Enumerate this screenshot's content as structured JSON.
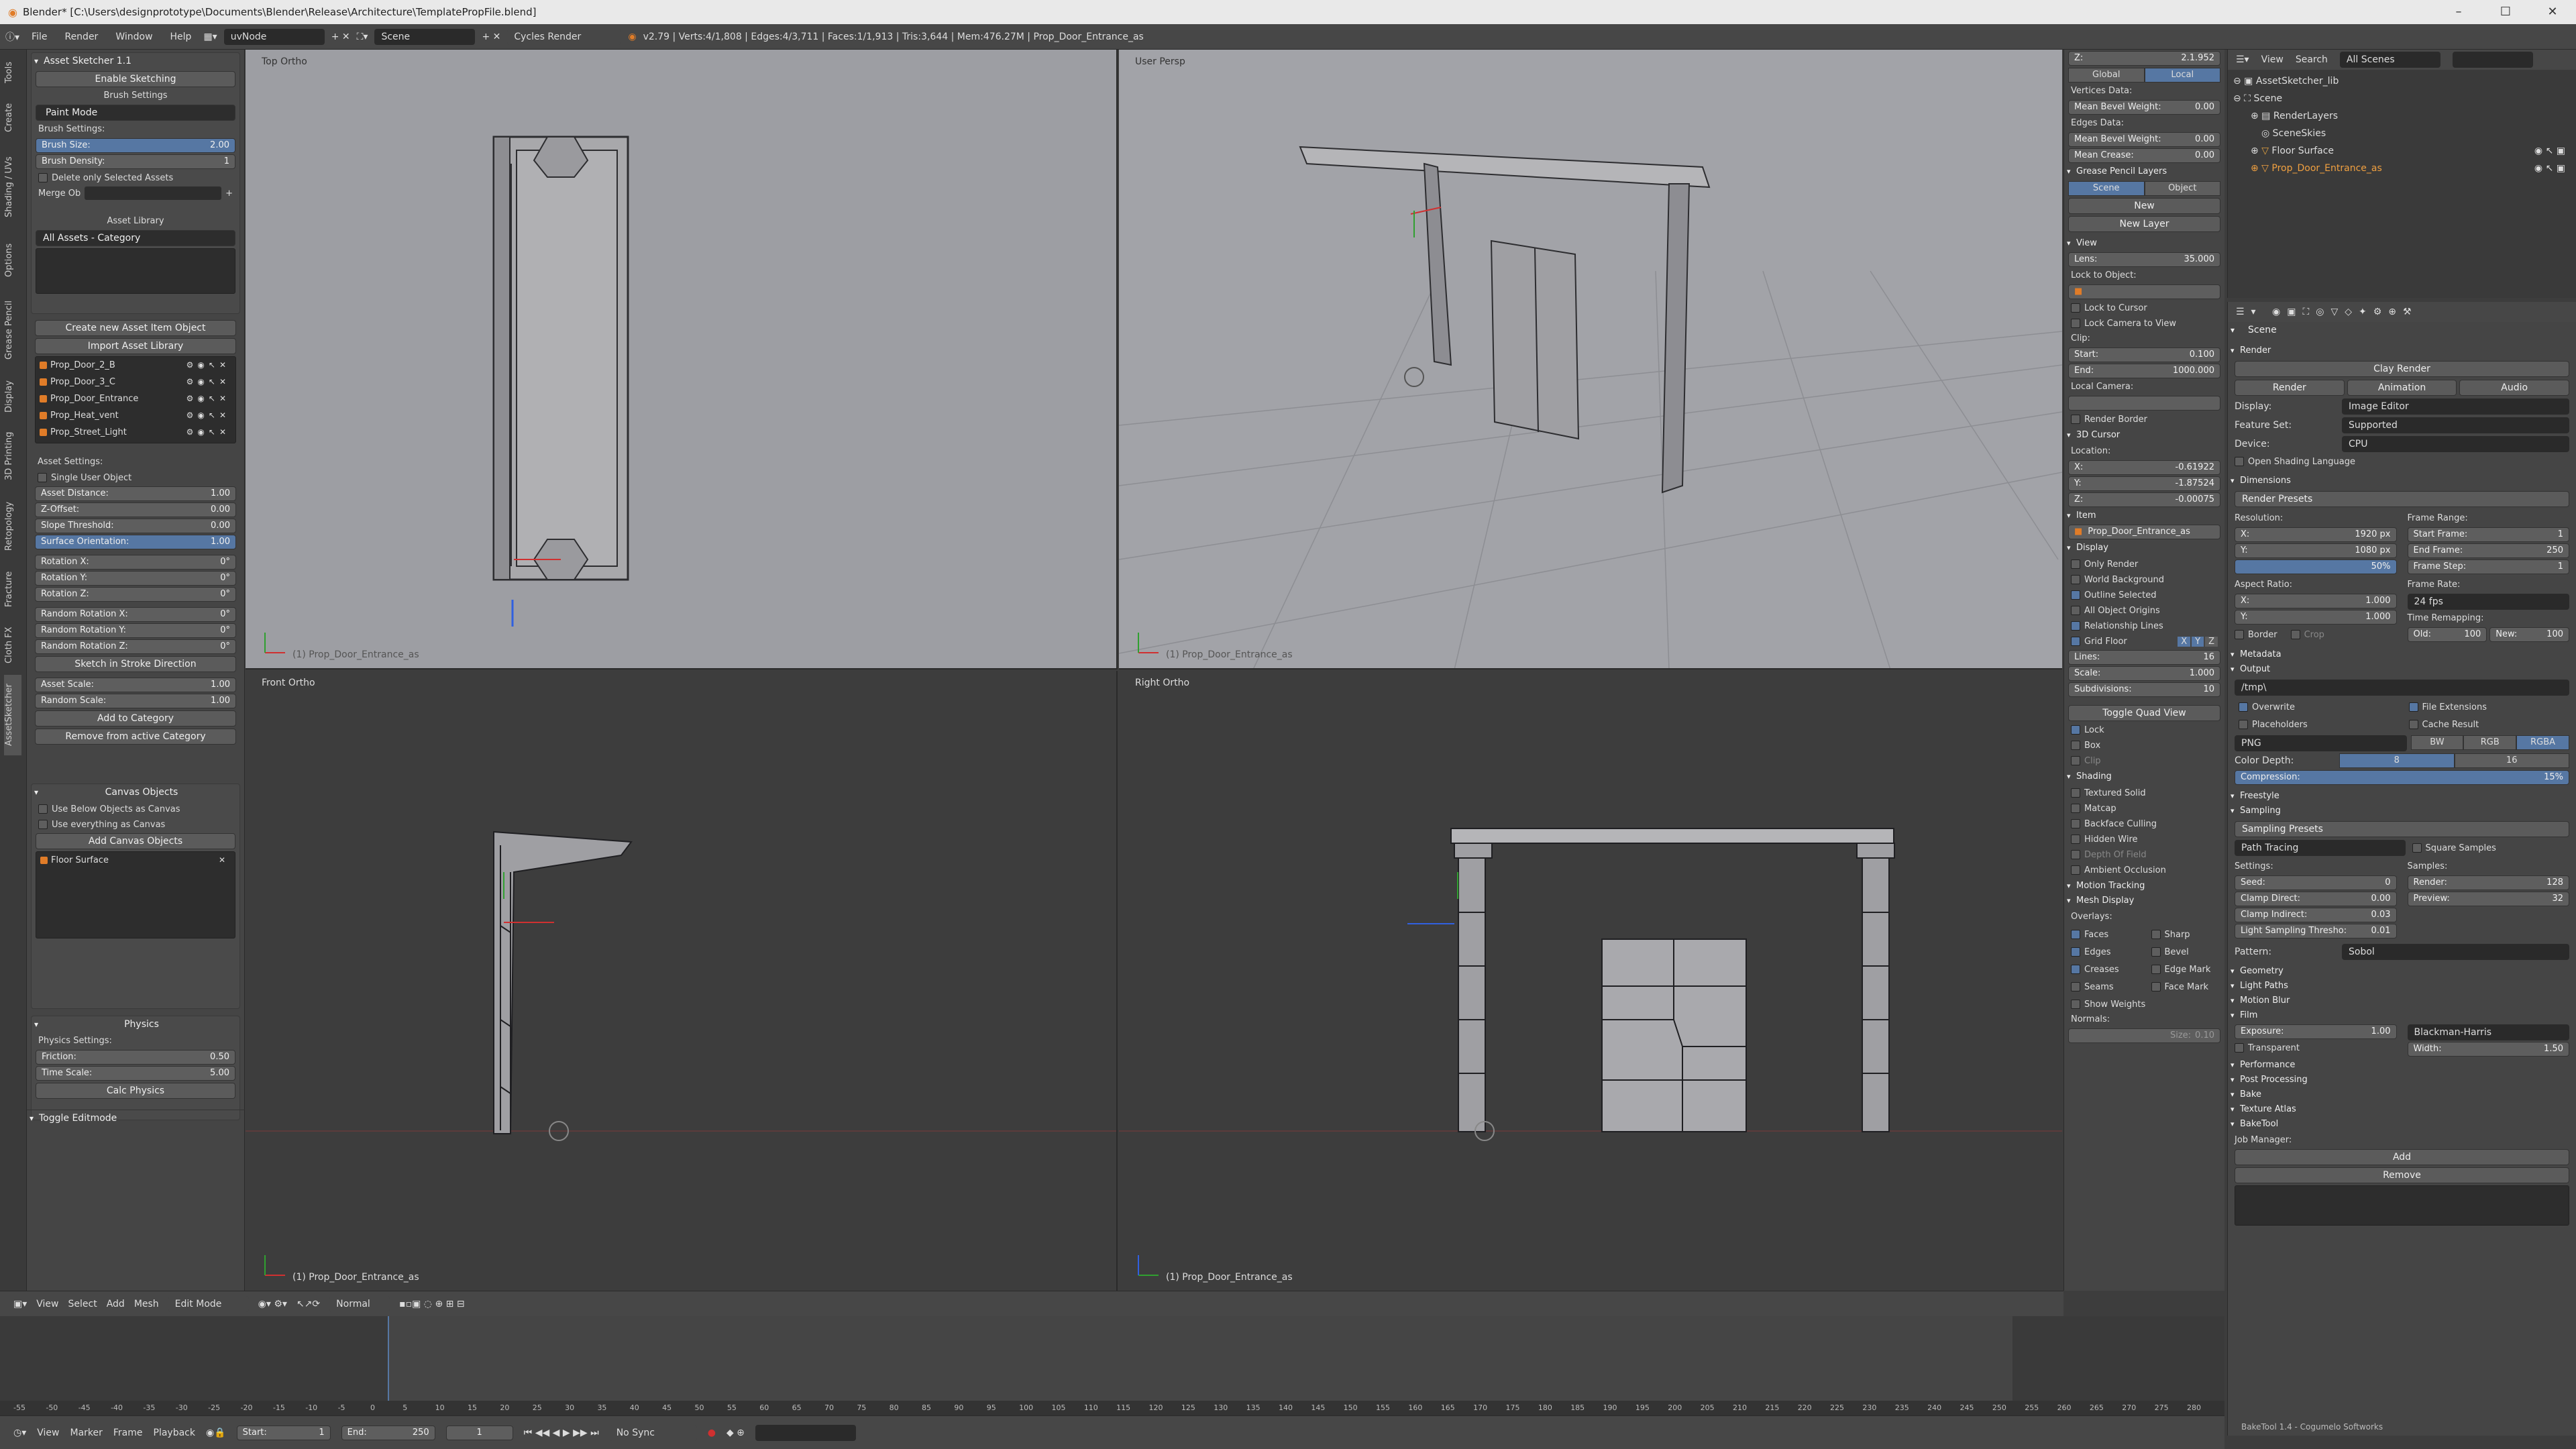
{
  "window": {
    "title": "Blender* [C:\\Users\\designprototype\\Documents\\Blender\\Release\\Architecture\\TemplatePropFile.blend]",
    "controls": [
      "–",
      "☐",
      "✕"
    ]
  },
  "info_bar": {
    "menus": [
      "File",
      "Render",
      "Window",
      "Help"
    ],
    "screen": "uvNode",
    "scene": "Scene",
    "engine": "Cycles Render",
    "stats": "v2.79 | Verts:4/1,808 | Edges:4/3,711 | Faces:1/1,913 | Tris:3,644 | Mem:476.27M | Prop_Door_Entrance_as"
  },
  "tool_tabs": [
    "Tools",
    "Create",
    "Shading / UVs",
    "Options",
    "Grease Pencil",
    "Display",
    "3D Printing",
    "Retopology",
    "Fracture",
    "Cloth FX",
    "AssetSketcher"
  ],
  "tool_shelf": {
    "header": "Asset Sketcher 1.1",
    "enable_sketching": "Enable Sketching",
    "brush_settings_title": "Brush Settings",
    "paint_mode": "Paint Mode",
    "brush_settings_label": "Brush Settings:",
    "brush_size_label": "Brush Size:",
    "brush_size": "2.00",
    "brush_density_label": "Brush Density:",
    "brush_density": "1",
    "delete_selected": "Delete only Selected Assets",
    "merge_ob": "Merge Ob",
    "asset_library_title": "Asset Library",
    "category": "All Assets - Category",
    "create_asset_btn": "Create new Asset Item Object",
    "import_library_btn": "Import Asset Library",
    "assets": [
      "Prop_Door_2_B",
      "Prop_Door_3_C",
      "Prop_Door_Entrance",
      "Prop_Heat_vent",
      "Prop_Street_Light"
    ],
    "asset_settings_label": "Asset Settings:",
    "single_user": "Single User Object",
    "fields": [
      {
        "label": "Asset Distance:",
        "value": "1.00"
      },
      {
        "label": "Z-Offset:",
        "value": "0.00"
      },
      {
        "label": "Slope Threshold:",
        "value": "0.00"
      },
      {
        "label": "Surface Orientation:",
        "value": "1.00"
      },
      {
        "label": "Rotation X:",
        "value": "0°"
      },
      {
        "label": "Rotation Y:",
        "value": "0°"
      },
      {
        "label": "Rotation Z:",
        "value": "0°"
      },
      {
        "label": "Random Rotation X:",
        "value": "0°"
      },
      {
        "label": "Random Rotation Y:",
        "value": "0°"
      },
      {
        "label": "Random Rotation Z:",
        "value": "0°"
      }
    ],
    "sketch_stroke": "Sketch in Stroke Direction",
    "asset_scale_label": "Asset Scale:",
    "asset_scale": "1.00",
    "random_scale_label": "Random Scale:",
    "random_scale": "1.00",
    "add_category": "Add to Category",
    "remove_category": "Remove from active Category",
    "canvas_title": "Canvas Objects",
    "use_below": "Use Below Objects as Canvas",
    "use_everything": "Use everything as Canvas",
    "add_canvas": "Add Canvas Objects",
    "canvas_item": "Floor Surface",
    "physics_title": "Physics",
    "physics_settings": "Physics Settings:",
    "friction_label": "Friction:",
    "friction": "0.50",
    "time_scale_label": "Time Scale:",
    "time_scale": "5.00",
    "calc_physics": "Calc Physics",
    "toggle_editmode": "Toggle Editmode"
  },
  "viewports": {
    "top_left": {
      "label": "Top Ortho",
      "footer": "(1) Prop_Door_Entrance_as"
    },
    "top_right": {
      "label": "User Persp",
      "footer": "(1) Prop_Door_Entrance_as"
    },
    "bottom_left": {
      "label": "Front Ortho",
      "footer": "(1) Prop_Door_Entrance_as"
    },
    "bottom_right": {
      "label": "Right Ortho",
      "footer": "(1) Prop_Door_Entrance_as"
    }
  },
  "n_panel": {
    "z_top": "2.1.952",
    "global": "Global",
    "local": "Local",
    "vertices_data": "Vertices Data:",
    "mean_bevel_weight": "Mean Bevel Weight:",
    "mbw_value": "0.00",
    "edges_data": "Edges Data:",
    "mean_bevel_weight2": "Mean Bevel Weight:",
    "mbw2_value": "0.00",
    "mean_crease": "Mean Crease:",
    "mc_value": "0.00",
    "gp_layers": "Grease Pencil Layers",
    "scene": "Scene",
    "object": "Object",
    "new": "New",
    "new_layer": "New Layer",
    "view": "View",
    "lens_label": "Lens:",
    "lens": "35.000",
    "lock_to_object": "Lock to Object:",
    "lock_cursor": "Lock to Cursor",
    "lock_camera": "Lock Camera to View",
    "clip": "Clip:",
    "start_label": "Start:",
    "clip_start": "0.100",
    "end_label": "End:",
    "clip_end": "1000.000",
    "local_camera": "Local Camera:",
    "render_border": "Render Border",
    "cursor": "3D Cursor",
    "location": "Location:",
    "cx_label": "X:",
    "cx": "-0.61922",
    "cy_label": "Y:",
    "cy": "-1.87524",
    "cz_label": "Z:",
    "cz": "-0.00075",
    "item": "Item",
    "item_name": "Prop_Door_Entrance_as",
    "display": "Display",
    "only_render": "Only Render",
    "world_bg": "World Background",
    "outline_selected": "Outline Selected",
    "all_origins": "All Object Origins",
    "relationship_lines": "Relationship Lines",
    "grid_floor": "Grid Floor",
    "axis_x": "X",
    "axis_y": "Y",
    "axis_z": "Z",
    "lines_label": "Lines:",
    "lines": "16",
    "scale_label": "Scale:",
    "scale": "1.000",
    "subdiv_label": "Subdivisions:",
    "subdiv": "10",
    "toggle_quad": "Toggle Quad View",
    "lock": "Lock",
    "box": "Box",
    "clip2": "Clip",
    "shading": "Shading",
    "textured_solid": "Textured Solid",
    "matcap": "Matcap",
    "backface": "Backface Culling",
    "hidden_wire": "Hidden Wire",
    "dof": "Depth Of Field",
    "ao": "Ambient Occlusion",
    "motion_tracking": "Motion Tracking",
    "mesh_display": "Mesh Display",
    "overlays": "Overlays:",
    "faces": "Faces",
    "sharp": "Sharp",
    "edges": "Edges",
    "bevel": "Bevel",
    "creases": "Creases",
    "edge_mark": "Edge Mark",
    "seams": "Seams",
    "face_mark": "Face Mark",
    "show_weights": "Show Weights",
    "normals": "Normals:",
    "size": "Size:",
    "size_value": "0.10"
  },
  "outliner": {
    "menus": [
      "View",
      "Search",
      "All Scenes"
    ],
    "items": [
      {
        "label": "AssetSketcher_lib",
        "indent": 0
      },
      {
        "label": "Scene",
        "indent": 0
      },
      {
        "label": "RenderLayers",
        "indent": 1
      },
      {
        "label": "SceneSkies",
        "indent": 1
      },
      {
        "label": "Floor Surface",
        "indent": 1
      },
      {
        "label": "Prop_Door_Entrance_as",
        "indent": 1
      }
    ]
  },
  "properties": {
    "scene": "Scene",
    "render": "Render",
    "clay_render": "Clay Render",
    "render_btn": "Render",
    "animation_btn": "Animation",
    "audio_btn": "Audio",
    "display_label": "Display:",
    "display_value": "Image Editor",
    "feature_set_label": "Feature Set:",
    "feature_set": "Supported",
    "device_label": "Device:",
    "device": "CPU",
    "osl": "Open Shading Language",
    "dimensions": "Dimensions",
    "render_presets": "Render Presets",
    "resolution": "Resolution:",
    "res_x_label": "X:",
    "res_x": "1920 px",
    "res_y_label": "Y:",
    "res_y": "1080 px",
    "res_pct": "50%",
    "frame_range": "Frame Range:",
    "start_frame_label": "Start Frame:",
    "start_frame": "1",
    "end_frame_label": "End Frame:",
    "end_frame": "250",
    "frame_step_label": "Frame Step:",
    "frame_step": "1",
    "aspect_ratio": "Aspect Ratio:",
    "asp_x_label": "X:",
    "asp_x": "1.000",
    "asp_y_label": "Y:",
    "asp_y": "1.000",
    "frame_rate": "Frame Rate:",
    "fps": "24 fps",
    "time_remapping": "Time Remapping:",
    "old_label": "Old:",
    "old": "100",
    "new_label": "New:",
    "new": "100",
    "border": "Border",
    "crop": "Crop",
    "metadata": "Metadata",
    "output": "Output",
    "output_path": "/tmp\\",
    "overwrite": "Overwrite",
    "file_ext": "File Extensions",
    "placeholders": "Placeholders",
    "cache_result": "Cache Result",
    "format": "PNG",
    "bw": "BW",
    "rgb": "RGB",
    "rgba": "RGBA",
    "color_depth": "Color Depth:",
    "depth_8": "8",
    "depth_16": "16",
    "compression_label": "Compression:",
    "compression": "15%",
    "freestyle": "Freestyle",
    "sampling": "Sampling",
    "sampling_presets": "Sampling Presets",
    "path_tracing": "Path Tracing",
    "square_samples": "Square Samples",
    "settings": "Settings:",
    "samples": "Samples:",
    "seed_label": "Seed:",
    "seed": "0",
    "render_samples_label": "Render:",
    "render_samples": "128",
    "clamp_direct_label": "Clamp Direct:",
    "clamp_direct": "0.00",
    "preview_label": "Preview:",
    "preview": "32",
    "clamp_indirect_label": "Clamp Indirect:",
    "clamp_indirect": "0.03",
    "light_thresh_label": "Light Sampling Thresho:",
    "light_thresh": "0.01",
    "pattern_label": "Pattern:",
    "pattern": "Sobol",
    "geometry": "Geometry",
    "light_paths": "Light Paths",
    "motion_blur": "Motion Blur",
    "film": "Film",
    "exposure_label": "Exposure:",
    "exposure": "1.00",
    "filter": "Blackman-Harris",
    "transparent": "Transparent",
    "width_label": "Width:",
    "width": "1.50",
    "performance": "Performance",
    "post_processing": "Post Processing",
    "bake": "Bake",
    "texture_atlas": "Texture Atlas",
    "baketool": "BakeTool",
    "job_manager": "Job Manager:",
    "add": "Add",
    "remove": "Remove",
    "footer": "BakeTool 1.4 - Cogumelo Softworks"
  },
  "viewport_header": {
    "menus": [
      "View",
      "Select",
      "Add",
      "Mesh"
    ],
    "mode": "Edit Mode",
    "orientation": "Normal"
  },
  "timeline": {
    "menus": [
      "View",
      "Marker",
      "Frame",
      "Playback"
    ],
    "start_label": "Start:",
    "start": "1",
    "end_label": "End:",
    "end": "250",
    "current": "1",
    "sync": "No Sync",
    "ruler": [
      "-55",
      "-50",
      "-45",
      "-40",
      "-35",
      "-30",
      "-25",
      "-20",
      "-15",
      "-10",
      "-5",
      "0",
      "5",
      "10",
      "15",
      "20",
      "25",
      "30",
      "35",
      "40",
      "45",
      "50",
      "55",
      "60",
      "65",
      "70",
      "75",
      "80",
      "85",
      "90",
      "95",
      "100",
      "105",
      "110",
      "115",
      "120",
      "125",
      "130",
      "135",
      "140",
      "145",
      "150",
      "155",
      "160",
      "165",
      "170",
      "175",
      "180",
      "185",
      "190",
      "195",
      "200",
      "205",
      "210",
      "215",
      "220",
      "225",
      "230",
      "235",
      "240",
      "245",
      "250",
      "255",
      "260",
      "265",
      "270",
      "275",
      "280"
    ]
  },
  "colors": {
    "accent": "#5677a3",
    "orange": "#e07c28",
    "panel": "#454545",
    "viewport_top": "#9d9ea3",
    "viewport_bottom": "#3d3d3d"
  }
}
